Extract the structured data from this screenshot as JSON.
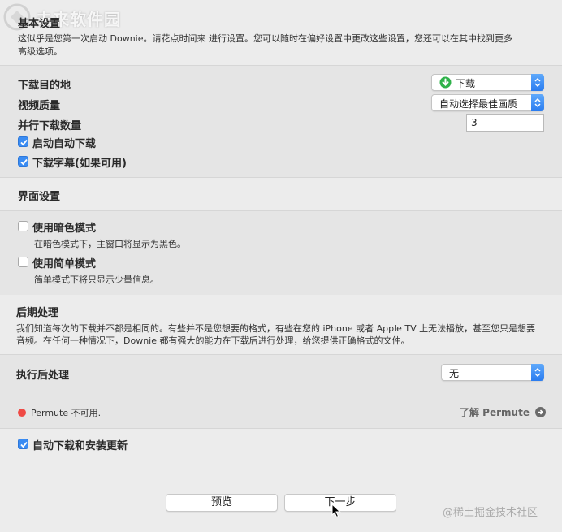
{
  "watermark_top": "未来软件园",
  "watermark_bottom": "@稀土掘金技术社区",
  "basic": {
    "title": "基本设置",
    "desc_line1": "这似乎是您第一次启动 Downie。请花点时间来 进行设置。您可以随时在偏好设置中更改这些设置，您还可以在其中找到更多",
    "desc_line2": "高级选项。"
  },
  "download": {
    "destination_label": "下载目的地",
    "destination_value": "下载",
    "quality_label": "视频质量",
    "quality_value": "自动选择最佳画质",
    "parallel_label": "并行下载数量",
    "parallel_value": "3",
    "auto_download_label": "启动自动下载",
    "auto_download_checked": true,
    "subtitles_label": "下载字幕(如果可用)",
    "subtitles_checked": true
  },
  "interface": {
    "title": "界面设置",
    "dark_label": "使用暗色模式",
    "dark_checked": false,
    "dark_desc": "在暗色模式下，主窗口将显示为黑色。",
    "simple_label": "使用简单模式",
    "simple_checked": false,
    "simple_desc": "简单模式下将只显示少量信息。"
  },
  "post": {
    "title": "后期处理",
    "desc_line1": "我们知道每次的下载并不都是相同的。有些并不是您想要的格式，有些在您的 iPhone 或者 Apple TV 上无法播放，甚至您只是想要",
    "desc_line2": "音频。在任何一种情况下，Downie 都有强大的能力在下载后进行处理，给您提供正确格式的文件。",
    "execute_label": "执行后处理",
    "execute_value": "无",
    "permute_status": "Permute 不可用.",
    "permute_link": "了解 Permute",
    "status_color": "#ef4a45"
  },
  "updates": {
    "label": "自动下载和安装更新",
    "checked": true
  },
  "buttons": {
    "preview": "预览",
    "next": "下一步"
  },
  "colors": {
    "accent": "#3a8cf3",
    "download_icon": "#2fb24a"
  }
}
